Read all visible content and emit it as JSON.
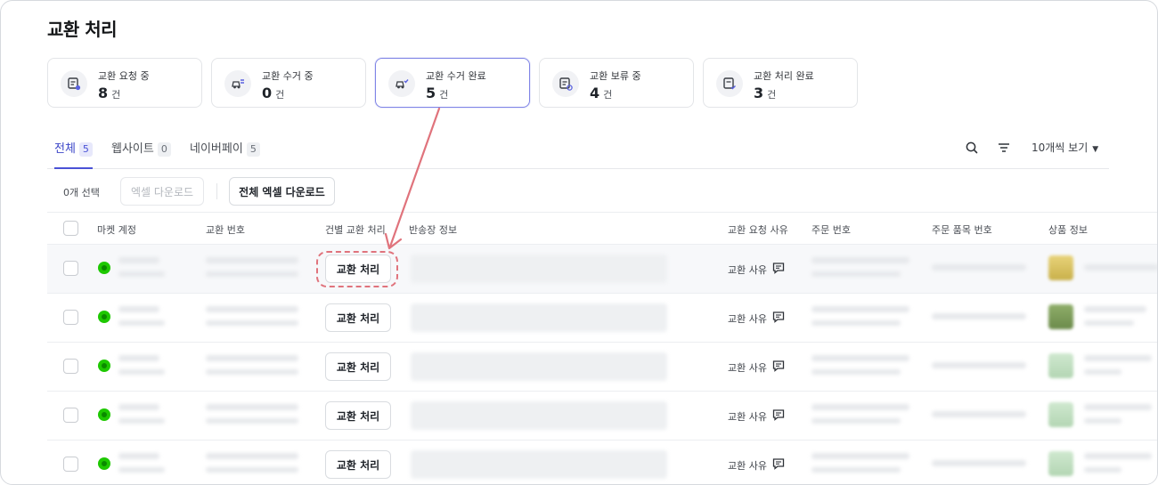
{
  "page": {
    "title": "교환 처리"
  },
  "status_cards": [
    {
      "label": "교환 요청 중",
      "count": "8",
      "unit": "건",
      "icon": "request-list-icon",
      "active": false
    },
    {
      "label": "교환 수거 중",
      "count": "0",
      "unit": "건",
      "icon": "pickup-truck-icon",
      "active": false
    },
    {
      "label": "교환 수거 완료",
      "count": "5",
      "unit": "건",
      "icon": "pickup-done-icon",
      "active": true
    },
    {
      "label": "교환 보류 중",
      "count": "4",
      "unit": "건",
      "icon": "hold-list-icon",
      "active": false
    },
    {
      "label": "교환 처리 완료",
      "count": "3",
      "unit": "건",
      "icon": "done-list-icon",
      "active": false
    }
  ],
  "tabs": [
    {
      "label": "전체",
      "count": "5",
      "active": true
    },
    {
      "label": "웹사이트",
      "count": "0",
      "active": false
    },
    {
      "label": "네이버페이",
      "count": "5",
      "active": false
    }
  ],
  "toolbar": {
    "view_select": "10개씩 보기",
    "search_icon": "search-icon",
    "filter_icon": "filter-icon"
  },
  "actions": {
    "selected_count": "0개 선택",
    "excel_download": "엑셀 다운로드",
    "excel_download_all": "전체 엑셀 다운로드"
  },
  "table": {
    "headers": {
      "market_account": "마켓 계정",
      "exchange_no": "교환 번호",
      "item_action": "건별 교환 처리",
      "return_invoice": "반송장 정보",
      "reason": "교환 요청 사유",
      "order_no": "주문 번호",
      "order_item_no": "주문 품목 번호",
      "product_info": "상품 정보"
    },
    "rows": [
      {
        "action": "교환 처리",
        "reason": "교환 사유",
        "highlighted": true
      },
      {
        "action": "교환 처리",
        "reason": "교환 사유",
        "highlighted": false
      },
      {
        "action": "교환 처리",
        "reason": "교환 사유",
        "highlighted": false
      },
      {
        "action": "교환 처리",
        "reason": "교환 사유",
        "highlighted": false
      },
      {
        "action": "교환 처리",
        "reason": "교환 사유",
        "highlighted": false
      }
    ]
  },
  "colors": {
    "accent": "#4a52d6",
    "annotation": "#e0737c",
    "market": "#1ec800"
  }
}
